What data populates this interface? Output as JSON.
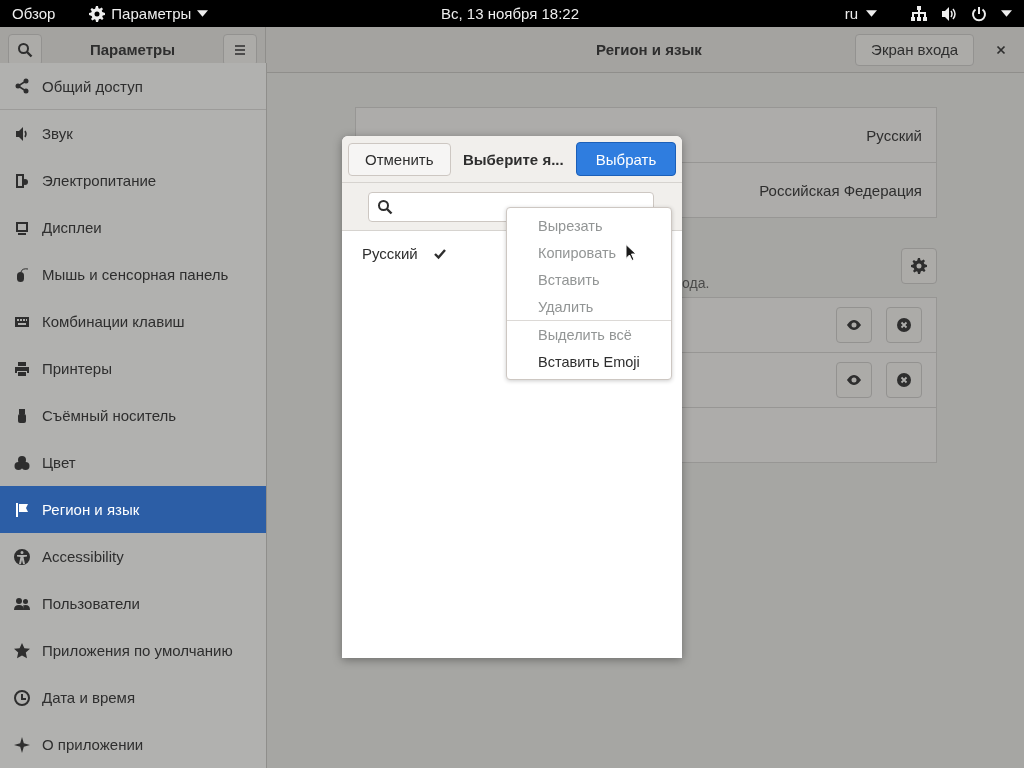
{
  "top_bar": {
    "activities": "Обзор",
    "app_menu": "Параметры",
    "clock": "Вс, 13 ноября  18:22",
    "keyboard_layout": "ru"
  },
  "header": {
    "sidebar_title": "Параметры",
    "title": "Регион и язык",
    "login_screen_button": "Экран входа"
  },
  "sidebar": {
    "items": [
      {
        "label": "Общий доступ",
        "selected": false
      },
      {
        "label": "Звук",
        "selected": false
      },
      {
        "label": "Электропитание",
        "selected": false
      },
      {
        "label": "Дисплеи",
        "selected": false
      },
      {
        "label": "Мышь и сенсорная панель",
        "selected": false
      },
      {
        "label": "Комбинации клавиш",
        "selected": false
      },
      {
        "label": "Принтеры",
        "selected": false
      },
      {
        "label": "Съёмный носитель",
        "selected": false
      },
      {
        "label": "Цвет",
        "selected": false
      },
      {
        "label": "Регион и язык",
        "selected": true
      },
      {
        "label": "Accessibility",
        "selected": false
      },
      {
        "label": "Пользователи",
        "selected": false
      },
      {
        "label": "Приложения по умолчанию",
        "selected": false
      },
      {
        "label": "Дата и время",
        "selected": false
      },
      {
        "label": "О приложении",
        "selected": false
      }
    ]
  },
  "settings": {
    "rows": [
      {
        "value": "Русский"
      },
      {
        "value": "Российская Федерация"
      }
    ],
    "input_sources_hint": "ода.",
    "input_sources": [
      {
        "kind": "source"
      },
      {
        "kind": "source"
      },
      {
        "kind": "empty"
      }
    ]
  },
  "dialog": {
    "cancel": "Отменить",
    "title": "Выберите я...",
    "confirm": "Выбрать",
    "languages": [
      {
        "name": "Русский",
        "checked": true
      }
    ]
  },
  "context_menu": {
    "items": [
      {
        "label": "Вырезать",
        "disabled": true,
        "separator_before": false
      },
      {
        "label": "Копировать",
        "disabled": true,
        "separator_before": false
      },
      {
        "label": "Вставить",
        "disabled": true,
        "separator_before": false
      },
      {
        "label": "Удалить",
        "disabled": true,
        "separator_before": false
      },
      {
        "label": "Выделить всё",
        "disabled": true,
        "separator_before": true
      },
      {
        "label": "Вставить Emoji",
        "disabled": false,
        "separator_before": false
      }
    ]
  }
}
